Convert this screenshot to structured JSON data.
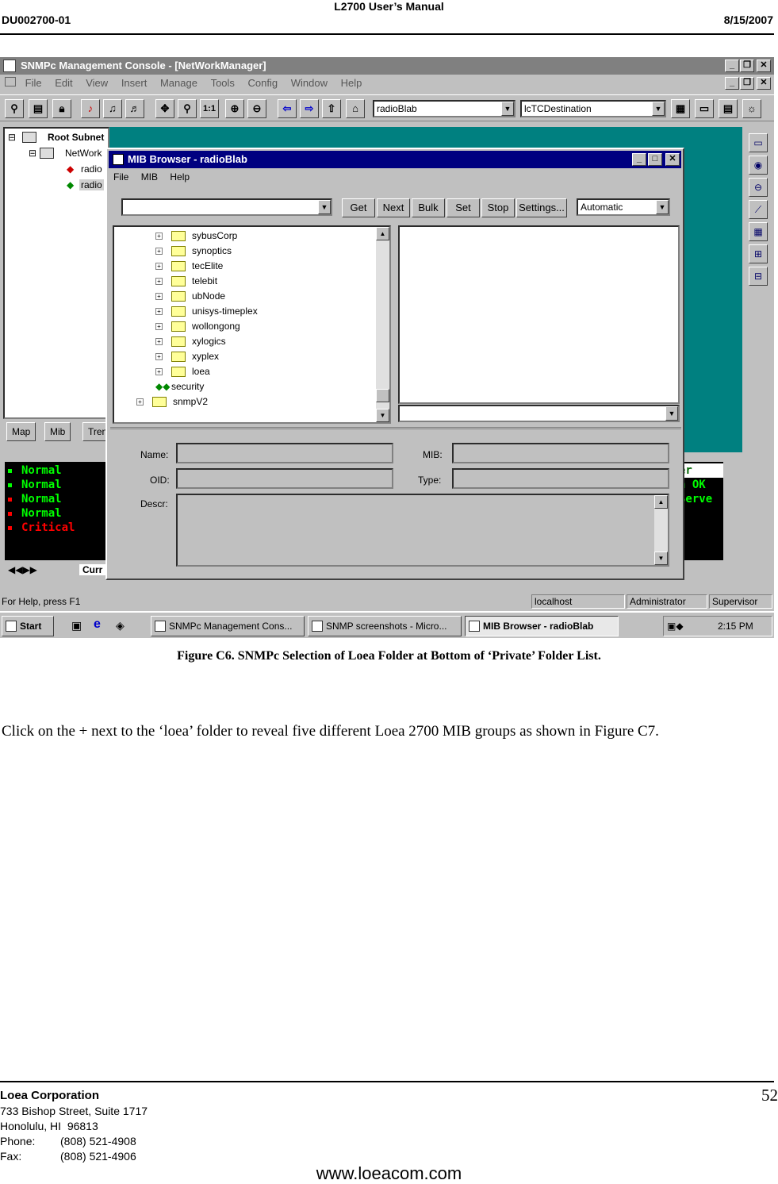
{
  "header": {
    "title": "L2700 User’s Manual",
    "doc_number": "DU002700-01",
    "date": "8/15/2007"
  },
  "screenshot": {
    "main_window": {
      "title": "SNMPc Management Console - [NetWorkManager]",
      "menu": [
        "File",
        "Edit",
        "View",
        "Insert",
        "Manage",
        "Tools",
        "Config",
        "Window",
        "Help"
      ],
      "combo_left": "radioBlab",
      "combo_right": "lcTCDestination"
    },
    "tree": {
      "root": "Root Subnet",
      "network": "NetWork",
      "items": [
        "radio",
        "radio"
      ]
    },
    "tabs": [
      "Map",
      "Mib",
      "Tren"
    ],
    "events": [
      {
        "text": "Normal",
        "color": "#00ff00"
      },
      {
        "text": "Normal",
        "color": "#00ff00"
      },
      {
        "text": "Normal",
        "color": "#00ff00"
      },
      {
        "text": "Normal",
        "color": "#00ff00"
      },
      {
        "text": "Critical",
        "color": "#ff0000"
      }
    ],
    "event_right": [
      "er",
      "n OK",
      "Serve"
    ],
    "event_tab": "Curr",
    "mib_browser": {
      "title": "MIB Browser - radioBlab",
      "menu": [
        "File",
        "MIB",
        "Help"
      ],
      "buttons": [
        "Get",
        "Next",
        "Bulk",
        "Set",
        "Stop",
        "Settings..."
      ],
      "mode": "Automatic",
      "tree_nodes": [
        "sybusCorp",
        "synoptics",
        "tecElite",
        "telebit",
        "ubNode",
        "unisys-timeplex",
        "wollongong",
        "xylogics",
        "xyplex",
        "loea",
        "security",
        "snmpV2"
      ],
      "labels": {
        "name": "Name:",
        "mib": "MIB:",
        "oid": "OID:",
        "type": "Type:",
        "descr": "Descr:"
      }
    },
    "status": {
      "help": "For Help, press F1",
      "host": "localhost",
      "user": "Administrator",
      "role": "Supervisor"
    },
    "taskbar": {
      "start": "Start",
      "tasks": [
        "SNMPc Management Cons...",
        "SNMP screenshots - Micro...",
        "MIB Browser - radioBlab"
      ],
      "clock": "2:15 PM"
    }
  },
  "caption": "Figure C6.  SNMPc Selection of Loea Folder at Bottom of ‘Private’ Folder List.",
  "body_text": "Click on the + next to the ‘loea’ folder to reveal five different Loea 2700 MIB groups as shown in Figure C7.",
  "footer": {
    "company": "Loea Corporation",
    "address1": "733 Bishop Street, Suite 1717",
    "address2": "Honolulu, HI  96813",
    "phone_label": "Phone:",
    "phone": "(808) 521-4908",
    "fax_label": "Fax:",
    "fax": "(808) 521-4906",
    "page": "52",
    "website": "www.loeacom.com"
  }
}
